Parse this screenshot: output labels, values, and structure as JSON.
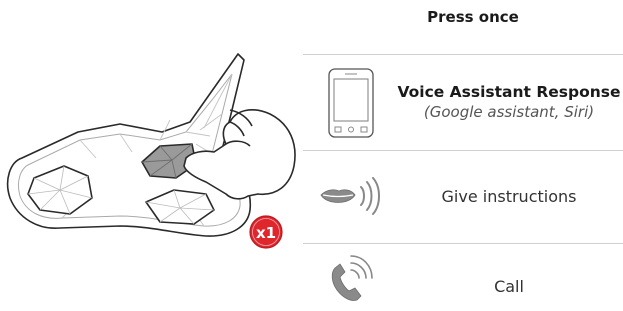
{
  "header": {
    "title": "Press once"
  },
  "badge": {
    "label": "x1",
    "color": "#e0262d"
  },
  "rows": [
    {
      "icon": "smartphone-icon",
      "title": "Voice Assistant Response",
      "subtitle": "(Google assistant, Siri)"
    },
    {
      "icon": "speaking-mouth-icon",
      "label": "Give instructions"
    },
    {
      "icon": "phone-call-icon",
      "label": "Call"
    }
  ],
  "colors": {
    "accent_grey": "#888888",
    "divider": "#cfcfcf",
    "badge_red": "#e0262d"
  }
}
